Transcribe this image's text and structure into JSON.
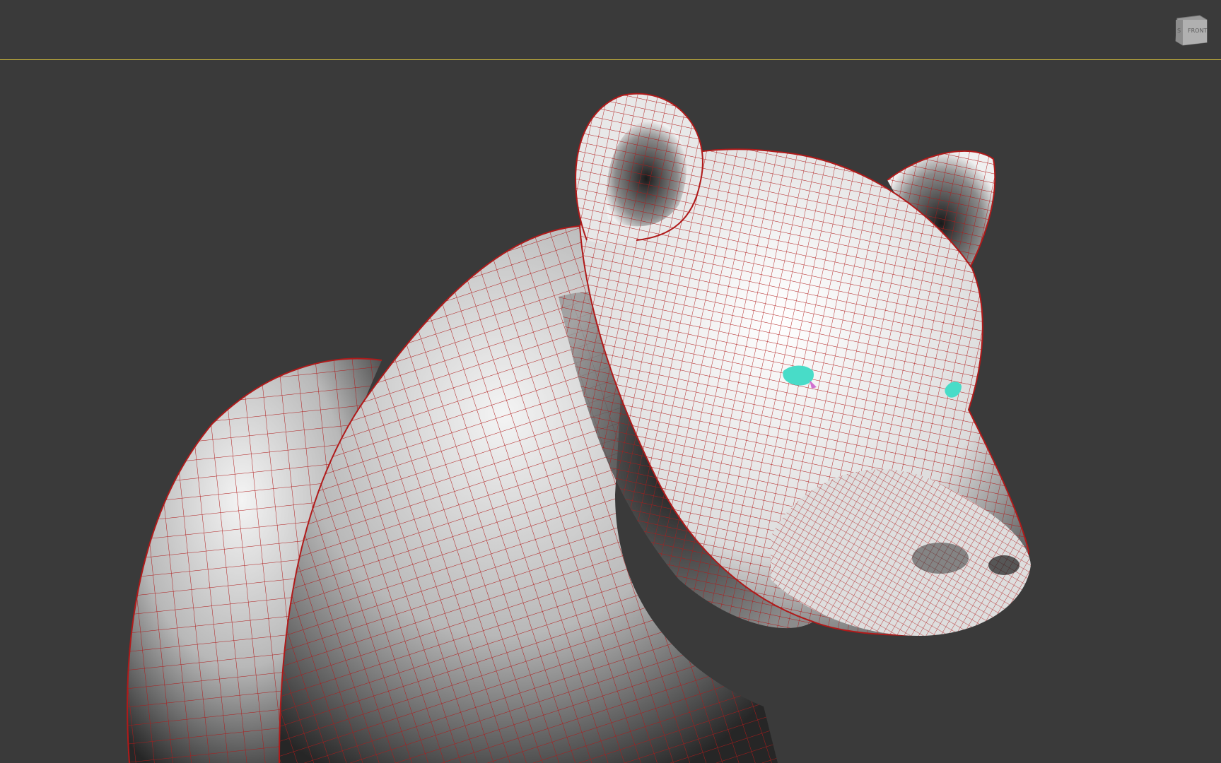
{
  "viewport": {
    "background_color": "#3a3a3a",
    "border_color": "#c8b43c",
    "wire_color": "#b01a1a",
    "shade_light": "#f2f2f2",
    "shade_dark": "#1e1e1e",
    "eye_color": "#48dcc8"
  },
  "viewcube": {
    "front_label": "FRONT",
    "side_label": "S"
  },
  "scene": {
    "object_icon": "bear-mesh"
  }
}
